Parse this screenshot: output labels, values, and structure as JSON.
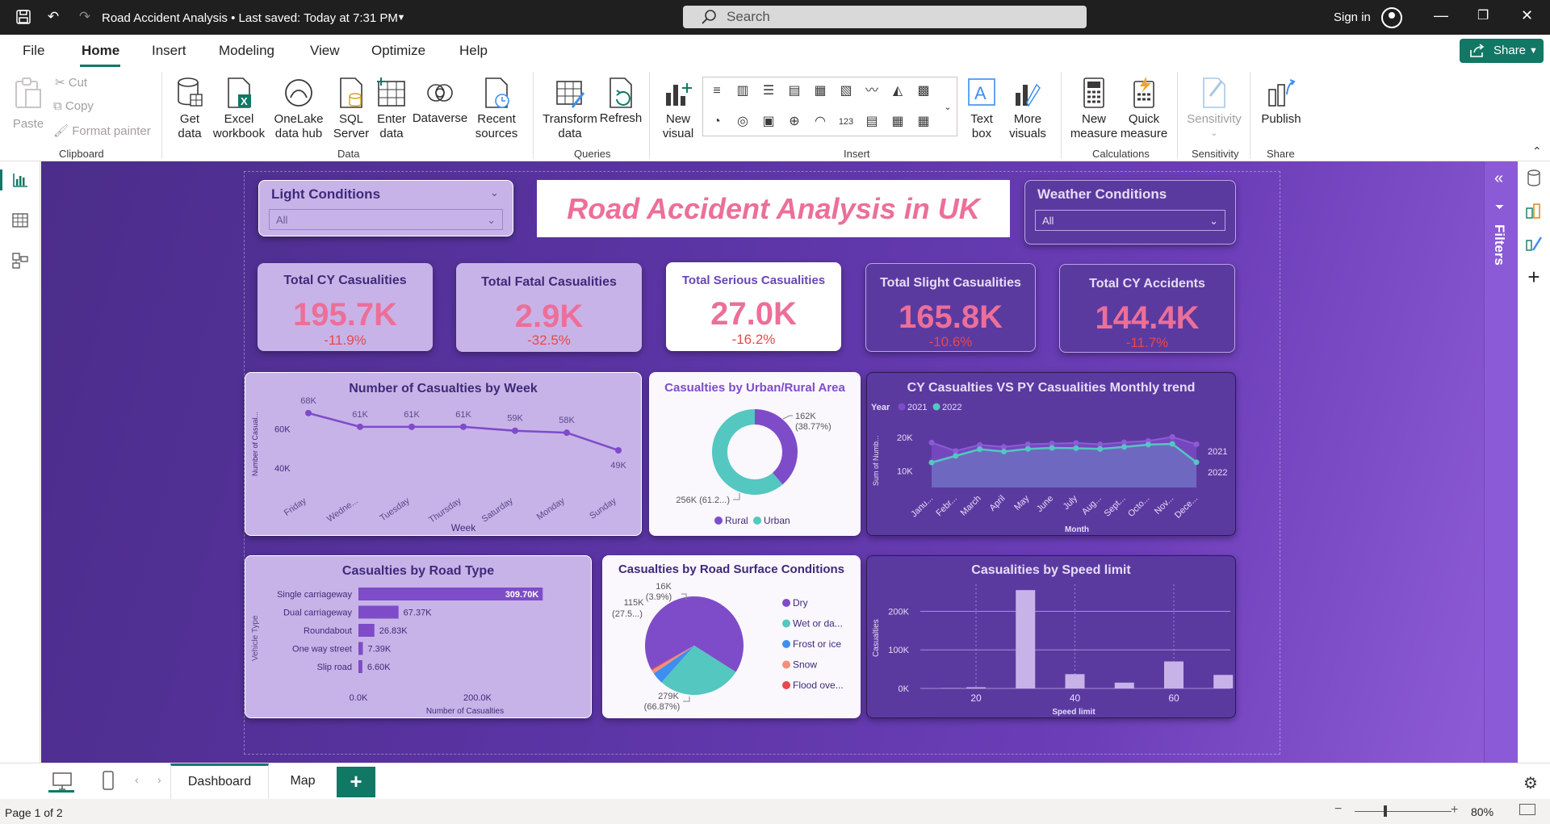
{
  "titlebar": {
    "doc_title": "Road Accident Analysis  •  Last saved: Today at 7:31 PM",
    "search_placeholder": "Search",
    "signin": "Sign in"
  },
  "menu": [
    "File",
    "Home",
    "Insert",
    "Modeling",
    "View",
    "Optimize",
    "Help"
  ],
  "share_label": "Share",
  "ribbon": {
    "clipboard": {
      "paste": "Paste",
      "cut": "Cut",
      "copy": "Copy",
      "format_painter": "Format painter",
      "group": "Clipboard"
    },
    "data": {
      "get_data": "Get data",
      "excel": "Excel workbook",
      "onelake": "OneLake data hub",
      "sql": "SQL Server",
      "enter": "Enter data",
      "dataverse": "Dataverse",
      "recent": "Recent sources",
      "group": "Data"
    },
    "queries": {
      "transform": "Transform data",
      "refresh": "Refresh",
      "group": "Queries"
    },
    "insert": {
      "new_visual": "New visual",
      "text_box": "Text box",
      "more_visuals": "More visuals",
      "group": "Insert"
    },
    "calculations": {
      "new_measure": "New measure",
      "quick_measure": "Quick measure",
      "group": "Calculations"
    },
    "sensitivity": {
      "label": "Sensitivity",
      "group": "Sensitivity"
    },
    "share": {
      "publish": "Publish",
      "group": "Share"
    }
  },
  "dashboard": {
    "title": "Road Accident Analysis in UK",
    "light_slicer": {
      "title": "Light Conditions",
      "value": "All"
    },
    "weather_slicer": {
      "title": "Weather Conditions",
      "value": "All"
    },
    "kpis": [
      {
        "title": "Total CY Casualities",
        "value": "195.7K",
        "delta": "-11.9%"
      },
      {
        "title": "Total Fatal Casualities",
        "value": "2.9K",
        "delta": "-32.5%"
      },
      {
        "title": "Total Serious Casualities",
        "value": "27.0K",
        "delta": "-16.2%"
      },
      {
        "title": "Total Slight Casualities",
        "value": "165.8K",
        "delta": "-10.6%"
      },
      {
        "title": "Total CY Accidents",
        "value": "144.4K",
        "delta": "-11.7%"
      }
    ]
  },
  "filters_label": "Filters",
  "tabs": [
    "Dashboard",
    "Map"
  ],
  "status": {
    "page": "Page 1 of 2",
    "zoom": "80%"
  },
  "colors": {
    "accent": "#117865",
    "kpi_value": "#ec6f99",
    "delta": "#e5484d",
    "purple": "#7e4cc9",
    "teal": "#53c7c0"
  },
  "chart_data": [
    {
      "type": "line",
      "title": "Number of Casualties by Week",
      "xlabel": "Week",
      "ylabel": "Number of Casual...",
      "categories": [
        "Friday",
        "Wedne...",
        "Tuesday",
        "Thursday",
        "Saturday",
        "Monday",
        "Sunday"
      ],
      "values": [
        68000,
        61000,
        61000,
        61000,
        59000,
        58000,
        49000
      ],
      "data_labels": [
        "68K",
        "61K",
        "61K",
        "61K",
        "59K",
        "58K",
        "49K"
      ],
      "yticks": [
        "60K",
        "40K"
      ]
    },
    {
      "type": "pie",
      "title": "Casualties by Urban/Rural Area",
      "variant": "donut",
      "slices": [
        {
          "name": "Rural",
          "value": 162000,
          "label": "162K",
          "pct": "(38.77%)",
          "color": "#7e4cc9"
        },
        {
          "name": "Urban",
          "value": 256000,
          "label": "256K (61.2...)",
          "color": "#53c7c0"
        }
      ]
    },
    {
      "type": "area",
      "title": "CY Casualties VS PY Casualities Monthly trend",
      "legend_title": "Year",
      "xlabel": "Month",
      "ylabel": "Sum of Numb...",
      "categories": [
        "Janu...",
        "Febr...",
        "March",
        "April",
        "May",
        "June",
        "July",
        "Aug...",
        "Sept...",
        "Octo...",
        "Nov...",
        "Dece..."
      ],
      "series": [
        {
          "name": "2021",
          "values": [
            18500,
            16000,
            17800,
            17200,
            18000,
            18200,
            18400,
            18000,
            18600,
            19000,
            20200,
            18000
          ]
        },
        {
          "name": "2022",
          "values": [
            12500,
            14500,
            16500,
            15800,
            16600,
            16900,
            16800,
            16600,
            17200,
            17900,
            18100,
            12600
          ]
        }
      ],
      "yticks": [
        "20K",
        "10K"
      ]
    },
    {
      "type": "bar",
      "title": "Casualties by Road Type",
      "orientation": "horizontal",
      "xlabel": "Number of Casualties",
      "ylabel": "Vehicle Type",
      "categories": [
        "Single carriageway",
        "Dual carriageway",
        "Roundabout",
        "One way street",
        "Slip road"
      ],
      "values": [
        309700,
        67370,
        26830,
        7390,
        6600
      ],
      "data_labels": [
        "309.70K",
        "67.37K",
        "26.83K",
        "7.39K",
        "6.60K"
      ],
      "xticks": [
        "0.0K",
        "200.0K"
      ]
    },
    {
      "type": "pie",
      "title": "Casualties by Road Surface Conditions",
      "slices": [
        {
          "name": "Dry",
          "value": 279000,
          "label": "279K",
          "pct": "(66.87%)",
          "color": "#7e4cc9"
        },
        {
          "name": "Wet or da...",
          "value": 115000,
          "label": "115K",
          "pct": "(27.5...)",
          "color": "#53c7c0"
        },
        {
          "name": "Frost or ice",
          "value": 16000,
          "label": "16K",
          "pct": "(3.9%)",
          "color": "#3d8ef0"
        },
        {
          "name": "Snow",
          "value": 5000,
          "color": "#f2907a"
        },
        {
          "name": "Flood ove...",
          "value": 1500,
          "color": "#e5484d"
        }
      ]
    },
    {
      "type": "bar",
      "title": "Casualities by Speed limit",
      "xlabel": "Speed limit",
      "ylabel": "Casualties",
      "x": [
        15,
        20,
        30,
        40,
        50,
        60,
        70
      ],
      "values": [
        1000,
        3000,
        255000,
        37000,
        15000,
        70000,
        35000
      ],
      "xticks": [
        "20",
        "40",
        "60"
      ],
      "yticks": [
        "200K",
        "100K",
        "0K"
      ],
      "ylim": [
        0,
        270000
      ]
    }
  ]
}
